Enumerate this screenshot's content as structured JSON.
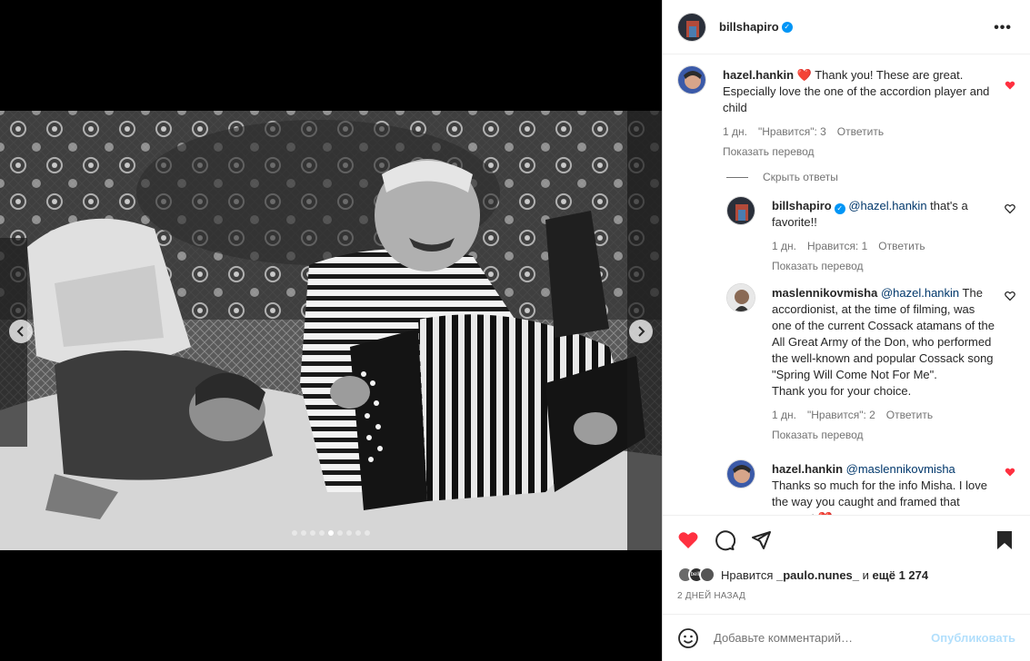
{
  "post": {
    "author": "billshapiro",
    "more_label": "•••",
    "dots_count": 9,
    "active_dot": 5
  },
  "comments": [
    {
      "user": "hazel.hankin",
      "text": "Thank you! These are great. Especially love the one of the accordion player and child",
      "time": "1 дн.",
      "likes": "\"Нравится\": 3",
      "reply": "Ответить",
      "translate": "Показать перевод",
      "liked": true
    }
  ],
  "hide_replies": "Скрыть ответы",
  "replies": [
    {
      "user": "billshapiro",
      "mention": "@hazel.hankin",
      "text": " that's a favorite!!",
      "time": "1 дн.",
      "likes": "Нравится: 1",
      "reply": "Ответить",
      "translate": "Показать перевод"
    },
    {
      "user": "maslennikovmisha",
      "mention": "@hazel.hankin",
      "text": " The accordionist, at the time of filming, was one of the current Cossack atamans of the All Great Army of the Don, who performed the well-known and popular Cossack song \"Spring Will Come Not For Me\".",
      "text2": "Thank you for your choice.",
      "time": "1 дн.",
      "likes": "\"Нравится\": 2",
      "reply": "Ответить",
      "translate": "Показать перевод"
    },
    {
      "user": "hazel.hankin",
      "mention": "@maslennikovmisha",
      "text": "Thanks so much for the info Misha. I love the way you caught and framed that moment"
    }
  ],
  "likes": {
    "prefix": "Нравится",
    "user": "_paulo.nunes_",
    "connector": "и",
    "more": "ещё 1 274",
    "stack_label": "bella"
  },
  "date": "2 ДНЕЙ НАЗАД",
  "add_comment": {
    "placeholder": "Добавьте комментарий…",
    "post_label": "Опубликовать"
  },
  "colors": {
    "like_red": "#ff3040",
    "verified_blue": "#0095f6",
    "post_disabled": "#b2dffc"
  }
}
